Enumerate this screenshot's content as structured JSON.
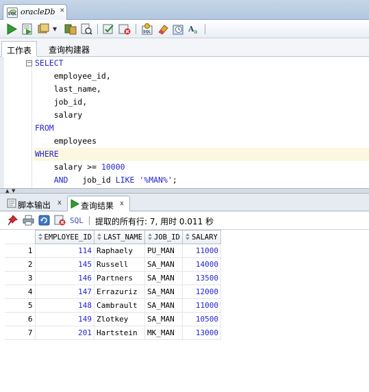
{
  "document_tab": {
    "title": "oracleDb",
    "icon": "sql-worksheet-icon"
  },
  "toolbar": {
    "icons": [
      "run-statement-icon",
      "run-script-icon",
      "commit-icon",
      "dropdown-arrow-icon",
      "explain-plan-icon",
      "autotrace-icon",
      "commit-check-icon",
      "rollback-icon",
      "sql-tuning-icon",
      "clear-icon",
      "history-icon",
      "format-icon"
    ]
  },
  "subtabs": {
    "worksheet": "工作表",
    "query_builder": "查询构建器"
  },
  "editor": {
    "lines": [
      {
        "kw": "SELECT",
        "rest": ""
      },
      {
        "kw": "",
        "rest": "    employee_id,"
      },
      {
        "kw": "",
        "rest": "    last_name,"
      },
      {
        "kw": "",
        "rest": "    job_id,"
      },
      {
        "kw": "",
        "rest": "    salary"
      },
      {
        "kw": "FROM",
        "rest": ""
      },
      {
        "kw": "",
        "rest": "    employees"
      },
      {
        "kw": "WHERE",
        "rest": ""
      },
      {
        "kw": "",
        "rest": "    salary >= ",
        "num": "10000"
      },
      {
        "kw": "",
        "rest": "    ",
        "and": "AND",
        "after_and": "   job_id ",
        "like": "LIKE",
        "str": " '%MAN%'",
        "end": ";"
      }
    ]
  },
  "panel_tabs": {
    "script_output": "脚本输出",
    "query_result": "查询结果"
  },
  "results_toolbar": {
    "sql_label": "SQL",
    "status": "提取的所有行: 7, 用时 0.011 秒"
  },
  "grid": {
    "columns": [
      "EMPLOYEE_ID",
      "LAST_NAME",
      "JOB_ID",
      "SALARY"
    ],
    "rows": [
      [
        "1",
        "114",
        "Raphaely",
        "PU_MAN",
        "11000"
      ],
      [
        "2",
        "145",
        "Russell",
        "SA_MAN",
        "14000"
      ],
      [
        "3",
        "146",
        "Partners",
        "SA_MAN",
        "13500"
      ],
      [
        "4",
        "147",
        "Errazuriz",
        "SA_MAN",
        "12000"
      ],
      [
        "5",
        "148",
        "Cambrault",
        "SA_MAN",
        "11000"
      ],
      [
        "6",
        "149",
        "Zlotkey",
        "SA_MAN",
        "10500"
      ],
      [
        "7",
        "201",
        "Hartstein",
        "MK_MAN",
        "13000"
      ]
    ]
  },
  "colors": {
    "keyword": "#2323d0",
    "highlight_line": "#fbf7e0",
    "toolbar_bg": "#e9eef4"
  }
}
